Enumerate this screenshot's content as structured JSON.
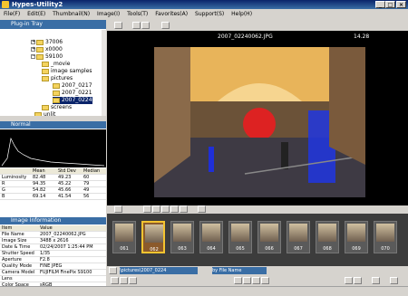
{
  "window": {
    "title": "Hypes-Utility2"
  },
  "menu": [
    "File(F)",
    "Edit(E)",
    "Thumbnail(N)",
    "Image(I)",
    "Tools(T)",
    "Favorites(A)",
    "Support(S)",
    "Help(H)"
  ],
  "left_panel": {
    "plug_in_tray": "Plug-in Tray",
    "tree": [
      "37006",
      "x0000",
      "59100",
      "_movie",
      "image samples",
      "pictures",
      "2007_0217",
      "2007_0221",
      "2007_0224",
      "screens",
      "unlit"
    ],
    "histogram_title": "Normal",
    "stats_headers": [
      "",
      "Mean",
      "Std Dev",
      "Median"
    ],
    "stats_rows": [
      [
        "Luminosity",
        "82.48",
        "49.23",
        "60"
      ],
      [
        "R",
        "94.35",
        "45.22",
        "79"
      ],
      [
        "G",
        "54.82",
        "45.66",
        "49"
      ],
      [
        "B",
        "69.14",
        "41.54",
        "56"
      ]
    ],
    "info_title": "Image Information",
    "info_headers": [
      "Item",
      "Value"
    ],
    "info_rows": [
      [
        "File Name",
        "2007_02240062.JPG"
      ],
      [
        "Image Size",
        "3488 x 2616"
      ],
      [
        "Date & Time",
        "02/24/2007 1:25:44 PM"
      ],
      [
        "Shutter Speed",
        "1/35"
      ],
      [
        "Aperture",
        "F2.8"
      ],
      [
        "Quality Mode",
        "FINE JPEG"
      ],
      [
        "Camera Model",
        "FUJIFILM FinePix S9100"
      ],
      [
        "Lens",
        ""
      ],
      [
        "Color Space",
        "sRGB"
      ]
    ]
  },
  "viewer": {
    "filename": "2007_02240062.JPG",
    "counter": "14.28"
  },
  "thumbnails": [
    "061",
    "062",
    "063",
    "064",
    "065",
    "066",
    "067",
    "068",
    "069",
    "070"
  ],
  "selected_thumb": "062",
  "path_combo": "\\pictures\\2007_0224",
  "sort_combo": "by File Name"
}
